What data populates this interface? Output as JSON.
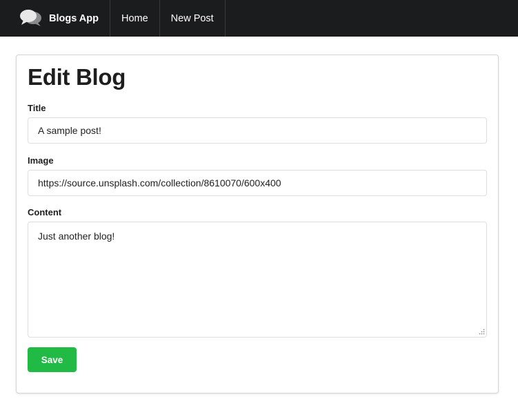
{
  "navbar": {
    "brand_icon": "comments-icon",
    "brand_label": "Blogs App",
    "items": [
      {
        "label": "Home"
      },
      {
        "label": "New Post"
      }
    ],
    "background": "#1b1c1d"
  },
  "form": {
    "heading": "Edit Blog",
    "title_label": "Title",
    "title_value": "A sample post!",
    "image_label": "Image",
    "image_value": "https://source.unsplash.com/collection/8610070/600x400",
    "content_label": "Content",
    "content_value": "Just another blog!",
    "save_label": "Save",
    "save_color": "#21ba45"
  }
}
